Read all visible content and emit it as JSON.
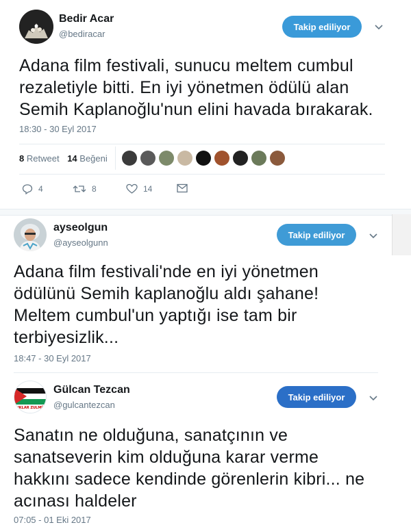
{
  "tweets": [
    {
      "name": "Bedir Acar",
      "handle": "@bediracar",
      "follow_label": "Takip ediliyor",
      "text_lines": [
        "Adana film festivali, sunucu meltem cumbul",
        "rezaletiyle bitti. En iyi yönetmen ödülü alan",
        "Semih Kaplanoğlu'nun elini havada bırakarak."
      ],
      "time": "18:30 - 30 Eyl 2017",
      "stats": {
        "retweet_count": "8",
        "retweet_label": "Retweet",
        "like_count": "14",
        "like_label": "Beğeni"
      },
      "actions": {
        "reply_count": "4",
        "retweet_count": "8",
        "like_count": "14"
      }
    },
    {
      "name": "ayseolgun",
      "handle": "@ayseolgunn",
      "follow_label": "Takip ediliyor",
      "text_lines": [
        "Adana film festivali'nde en iyi yönetmen",
        "ödülünü Semih kaplanoğlu aldı şahane!",
        "Meltem cumbul'un yaptığı ise tam bir",
        "terbiyesizlik..."
      ],
      "time": "18:47 - 30 Eyl 2017"
    },
    {
      "name": "Gülcan Tezcan",
      "handle": "@gulcantezcan",
      "follow_label": "Takip ediliyor",
      "avatar_text": "\"UKLAR ZULMÜ\"",
      "text_lines": [
        "Sanatın ne olduğuna, sanatçının ve",
        "sanatseverin kim olduğuna karar verme",
        "hakkını sadece kendinde görenlerin kibri... ne",
        "acınası haldeler"
      ],
      "time": "07:05 - 01 Eki 2017"
    }
  ],
  "colors": {
    "follow_button_1": "#3a9ad9",
    "follow_button_2": "#3f9bd6",
    "follow_button_3": "#2b6fc7",
    "text": "#14171a",
    "secondary": "#657786",
    "divider": "#e6ecf0"
  },
  "icons": [
    "chevron-down-icon",
    "reply-icon",
    "retweet-icon",
    "like-icon",
    "message-icon"
  ]
}
